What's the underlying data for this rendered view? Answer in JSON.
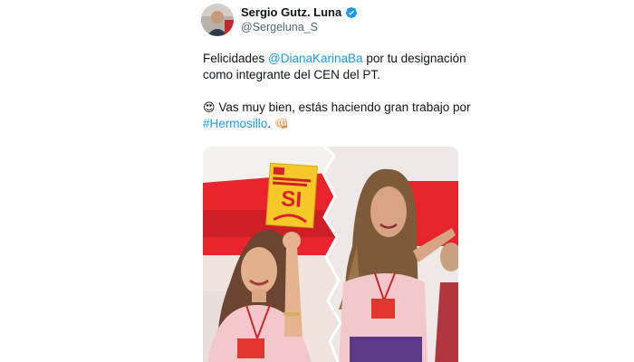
{
  "author": {
    "name": "Sergio Gutz. Luna",
    "handle": "@Sergeluna_S",
    "verified_icon": "verified-badge-icon"
  },
  "tweet": {
    "line1_prefix": "Felicidades ",
    "mention": "@DianaKarinaBa",
    "line1_suffix": " por tu designación como integrante del CEN del PT.",
    "emoji1": "😍",
    "line2_prefix": " Vas muy bien, estás haciendo gran trabajo por ",
    "hashtag": "#Hermosillo",
    "line2_suffix": ". ",
    "emoji2": "👊🏻"
  },
  "media": {
    "sign_text": "SI",
    "colors": {
      "link": "#1d9bf0",
      "verified": "#1d9bf0",
      "party_red": "#d8232a",
      "sign_yellow": "#f6c928"
    }
  }
}
